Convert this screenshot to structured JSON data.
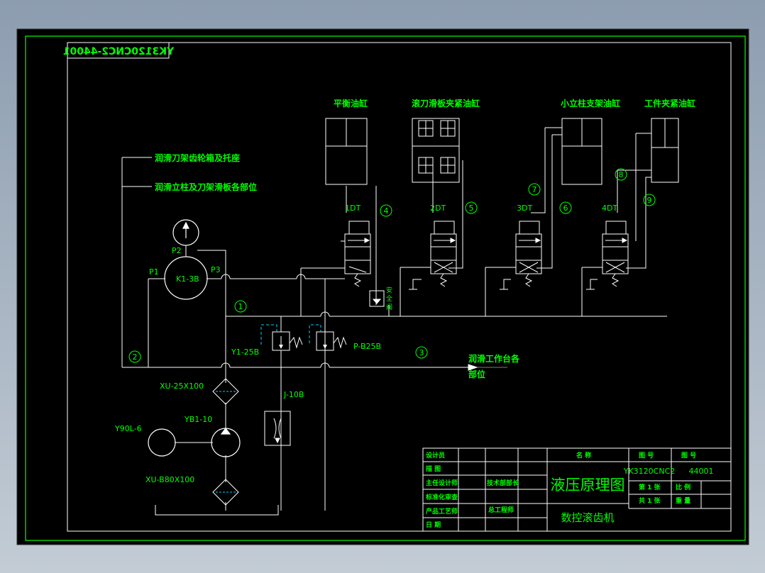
{
  "colors": {
    "background": "#000000",
    "frame": "#00ff00",
    "line": "#ffffff",
    "text": "#00ff00",
    "accent": "#00d0ff"
  },
  "drawing": {
    "mirrored_code": "YK3120CNC2-44001",
    "cylinders": {
      "balance": "平衡油缸",
      "slide_clamp": "滚刀滑板夹紧油缸",
      "column_clamp": "小立柱支架油缸",
      "workpiece_clamp": "工件夹紧油缸"
    },
    "valves": [
      "1DT",
      "2DT",
      "3DT",
      "4DT"
    ],
    "circled_numbers": [
      "1",
      "2",
      "3",
      "4",
      "5",
      "6",
      "7",
      "8",
      "9"
    ],
    "lube_labels": {
      "tool_gearbox": "润滑刀架齿轮箱及托座",
      "column_slide": "润滑立柱及刀架滑板各部位",
      "worktable_line1": "润滑工作台各",
      "worktable_line2": "部位"
    },
    "components": {
      "gauge_port": "P2",
      "port_p1": "P1",
      "port_p3": "P3",
      "gauge_switch": "K1-3B",
      "relief_valve": "Y1-25B",
      "pressure_valve": "P-B25B",
      "throttle": "J-10B",
      "filter_top": "XU-25X100",
      "filter_bottom": "XU-B80X100",
      "motor": "Y90L-6",
      "pump": "YB1-10",
      "safety_valve": [
        "安",
        "全",
        "阀"
      ]
    }
  },
  "title_block": {
    "rows": [
      "设计员",
      "描 图",
      "主任设计师",
      "标准化审查",
      "产品工艺师",
      "日 期"
    ],
    "mid_col": [
      "技术部部长",
      "总工程师"
    ],
    "name_header": "名 称",
    "title": "液压原理图",
    "product": "数控滚齿机",
    "drawing_no_header": "图 号",
    "drawing_no_header2": "图 号",
    "drawing_code": "YK3120CNC2",
    "drawing_number": "44001",
    "sheet_label": "第 1 张",
    "total_label": "共 1 张",
    "scale_label": "比 例",
    "weight_label": "重 量"
  }
}
